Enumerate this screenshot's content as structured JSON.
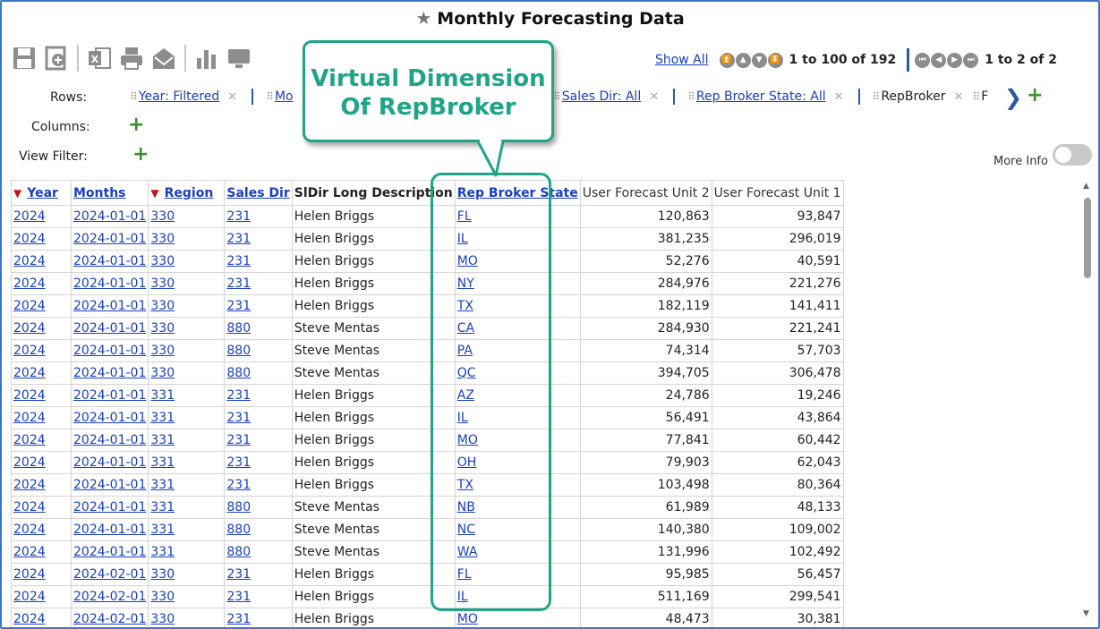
{
  "title": "Monthly Forecasting Data",
  "toolbar": {
    "icons": [
      "save-icon",
      "add-report-icon",
      "excel-icon",
      "print-icon",
      "email-icon",
      "chart-icon",
      "monitor-icon"
    ]
  },
  "pager": {
    "show_all": "Show All",
    "rows_range": "1 to 100 of 192",
    "page_range": "1 to 2 of 2"
  },
  "rows_label": "Rows:",
  "columns_label": "Columns:",
  "view_filter_label": "View Filter:",
  "row_chips": [
    {
      "label": "Year: Filtered",
      "link": true
    },
    {
      "label": "Mo",
      "link": true
    },
    {
      "label": "Sales Dir: All",
      "link": true
    },
    {
      "label": "Rep Broker State: All",
      "link": true
    },
    {
      "label": "RepBroker",
      "link": false
    },
    {
      "label": "F",
      "link": false
    }
  ],
  "more_info": "More Info",
  "callout": {
    "line1": "Virtual Dimension",
    "line2": "Of RepBroker"
  },
  "table": {
    "headers": [
      "Year",
      "Months",
      "Region",
      "Sales Dir",
      "SlDir Long Description",
      "Rep Broker State",
      "User Forecast Unit 2",
      "User Forecast Unit 1"
    ],
    "rows": [
      [
        "2024",
        "2024-01-01",
        "330",
        "231",
        "Helen Briggs",
        "FL",
        "120,863",
        "93,847"
      ],
      [
        "2024",
        "2024-01-01",
        "330",
        "231",
        "Helen Briggs",
        "IL",
        "381,235",
        "296,019"
      ],
      [
        "2024",
        "2024-01-01",
        "330",
        "231",
        "Helen Briggs",
        "MO",
        "52,276",
        "40,591"
      ],
      [
        "2024",
        "2024-01-01",
        "330",
        "231",
        "Helen Briggs",
        "NY",
        "284,976",
        "221,276"
      ],
      [
        "2024",
        "2024-01-01",
        "330",
        "231",
        "Helen Briggs",
        "TX",
        "182,119",
        "141,411"
      ],
      [
        "2024",
        "2024-01-01",
        "330",
        "880",
        "Steve Mentas",
        "CA",
        "284,930",
        "221,241"
      ],
      [
        "2024",
        "2024-01-01",
        "330",
        "880",
        "Steve Mentas",
        "PA",
        "74,314",
        "57,703"
      ],
      [
        "2024",
        "2024-01-01",
        "330",
        "880",
        "Steve Mentas",
        "QC",
        "394,705",
        "306,478"
      ],
      [
        "2024",
        "2024-01-01",
        "331",
        "231",
        "Helen Briggs",
        "AZ",
        "24,786",
        "19,246"
      ],
      [
        "2024",
        "2024-01-01",
        "331",
        "231",
        "Helen Briggs",
        "IL",
        "56,491",
        "43,864"
      ],
      [
        "2024",
        "2024-01-01",
        "331",
        "231",
        "Helen Briggs",
        "MO",
        "77,841",
        "60,442"
      ],
      [
        "2024",
        "2024-01-01",
        "331",
        "231",
        "Helen Briggs",
        "OH",
        "79,903",
        "62,043"
      ],
      [
        "2024",
        "2024-01-01",
        "331",
        "231",
        "Helen Briggs",
        "TX",
        "103,498",
        "80,364"
      ],
      [
        "2024",
        "2024-01-01",
        "331",
        "880",
        "Steve Mentas",
        "NB",
        "61,989",
        "48,133"
      ],
      [
        "2024",
        "2024-01-01",
        "331",
        "880",
        "Steve Mentas",
        "NC",
        "140,380",
        "109,002"
      ],
      [
        "2024",
        "2024-01-01",
        "331",
        "880",
        "Steve Mentas",
        "WA",
        "131,996",
        "102,492"
      ],
      [
        "2024",
        "2024-02-01",
        "330",
        "231",
        "Helen Briggs",
        "FL",
        "95,985",
        "56,457"
      ],
      [
        "2024",
        "2024-02-01",
        "330",
        "231",
        "Helen Briggs",
        "IL",
        "511,169",
        "299,541"
      ],
      [
        "2024",
        "2024-02-01",
        "330",
        "231",
        "Helen Briggs",
        "MO",
        "48,473",
        "30,381"
      ]
    ]
  }
}
